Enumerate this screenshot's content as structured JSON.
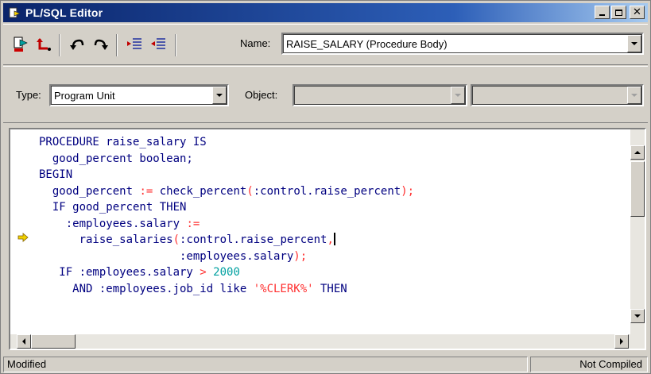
{
  "window": {
    "title": "PL/SQL Editor",
    "controls": [
      "minimize",
      "maximize",
      "close"
    ]
  },
  "toolbar": {
    "name_label": "Name:",
    "name_value": "RAISE_SALARY (Procedure Body)",
    "tools": [
      "compile-icon",
      "revert-icon",
      "undo-icon",
      "redo-icon",
      "indent-icon",
      "outdent-icon"
    ]
  },
  "selectors": {
    "type_label": "Type:",
    "type_value": "Program Unit",
    "object_label": "Object:",
    "object_value": "",
    "object_value2": ""
  },
  "editor": {
    "current_line_marker": "arrow-icon",
    "lines": [
      [
        {
          "t": "PROCEDURE raise_salary IS"
        }
      ],
      [
        {
          "t": "  good_percent boolean;"
        }
      ],
      [
        {
          "t": "BEGIN"
        }
      ],
      [
        {
          "t": "  good_percent "
        },
        {
          "t": ":=",
          "c": "op"
        },
        {
          "t": " check_percent"
        },
        {
          "t": "(",
          "c": "op"
        },
        {
          "t": ":control.raise_percent"
        },
        {
          "t": ");",
          "c": "op"
        }
      ],
      [
        {
          "t": "  IF good_percent THEN"
        }
      ],
      [
        {
          "t": "    :employees.salary "
        },
        {
          "t": ":=",
          "c": "op"
        }
      ],
      [
        {
          "t": "      raise_salaries"
        },
        {
          "t": "(",
          "c": "op"
        },
        {
          "t": ":control.raise_percent"
        },
        {
          "t": ",",
          "c": "op"
        },
        {
          "t": "",
          "caret": true
        }
      ],
      [
        {
          "t": "                     :employees.salary"
        },
        {
          "t": ");",
          "c": "op"
        }
      ],
      [
        {
          "t": "   IF :employees.salary "
        },
        {
          "t": ">",
          "c": "op"
        },
        {
          "t": " "
        },
        {
          "t": "2000",
          "c": "num"
        }
      ],
      [
        {
          "t": "     AND :employees.job_id like "
        },
        {
          "t": "'%CLERK%'",
          "c": "op"
        },
        {
          "t": " THEN"
        }
      ]
    ]
  },
  "status": {
    "left": "Modified",
    "right": "Not Compiled"
  },
  "colors": {
    "titlebar_start": "#0a246a",
    "titlebar_end": "#a6caf0",
    "code_text": "#000080",
    "operator": "#ff3030",
    "number": "#00a0a0"
  }
}
